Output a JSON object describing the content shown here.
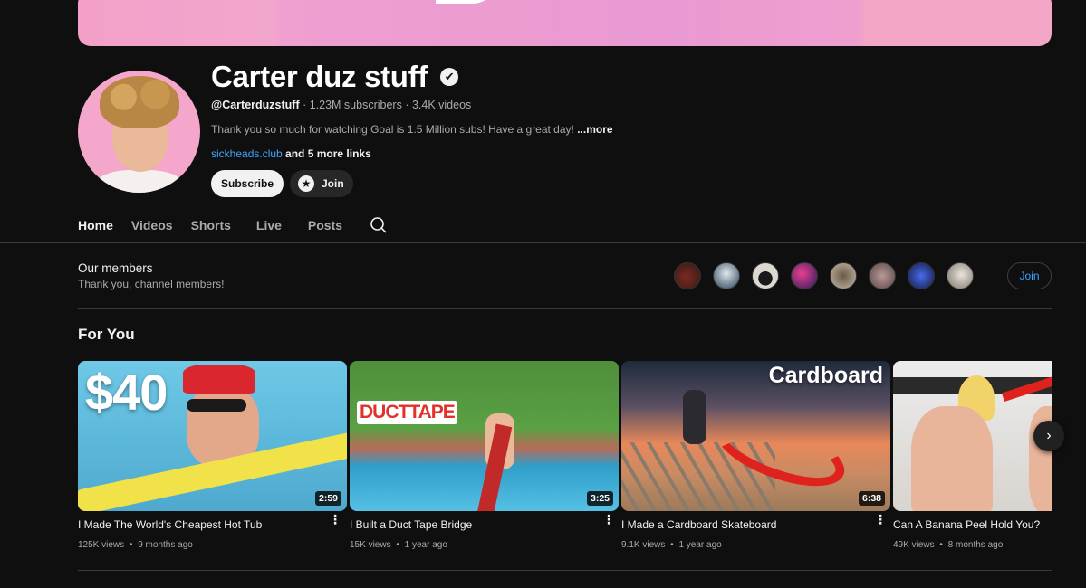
{
  "channel": {
    "name": "Carter duz stuff",
    "handle": "@Carterduzstuff",
    "stats": " · 1.23M subscribers · 3.4K videos",
    "description": "Thank you so much for watching Goal is 1.5 Million subs! Have a great day! ",
    "description_more": "...more",
    "link": "sickheads.club",
    "more_links": " and 5 more links",
    "verified_icon": "✔"
  },
  "buttons": {
    "subscribe": "Subscribe",
    "join": "Join",
    "star_icon": "★"
  },
  "tabs": [
    {
      "label": "Home"
    },
    {
      "label": "Videos"
    },
    {
      "label": "Shorts"
    },
    {
      "label": "Live"
    },
    {
      "label": "Posts"
    }
  ],
  "members": {
    "title": "Our members",
    "subtitle": "Thank you, channel members!",
    "join_label": "Join",
    "avatar_colors": [
      "#7a2a22",
      "#9fb6c9",
      "#ddd8d0",
      "#c02a6a",
      "#9a8a78",
      "#8a6a6a",
      "#2a3a8a",
      "#b8b2a6"
    ]
  },
  "section": {
    "title": "For You"
  },
  "videos": [
    {
      "title": "I Made The World's Cheapest Hot Tub",
      "views": "125K views",
      "age": "9 months ago",
      "duration": "2:59",
      "overlay": "$40"
    },
    {
      "title": "I Built a Duct Tape Bridge",
      "views": "15K views",
      "age": "1 year ago",
      "duration": "3:25",
      "overlay": "DUCTTAPE"
    },
    {
      "title": "I Made a Cardboard Skateboard",
      "views": "9.1K views",
      "age": "1 year ago",
      "duration": "6:38",
      "overlay": "Cardboard"
    },
    {
      "title": "Can A Banana Peel Hold You?",
      "views": "49K views",
      "age": "8 months ago",
      "duration": "",
      "overlay": ""
    }
  ],
  "dot_separator": "•",
  "menu_icon": "⋮",
  "next_icon": "›"
}
